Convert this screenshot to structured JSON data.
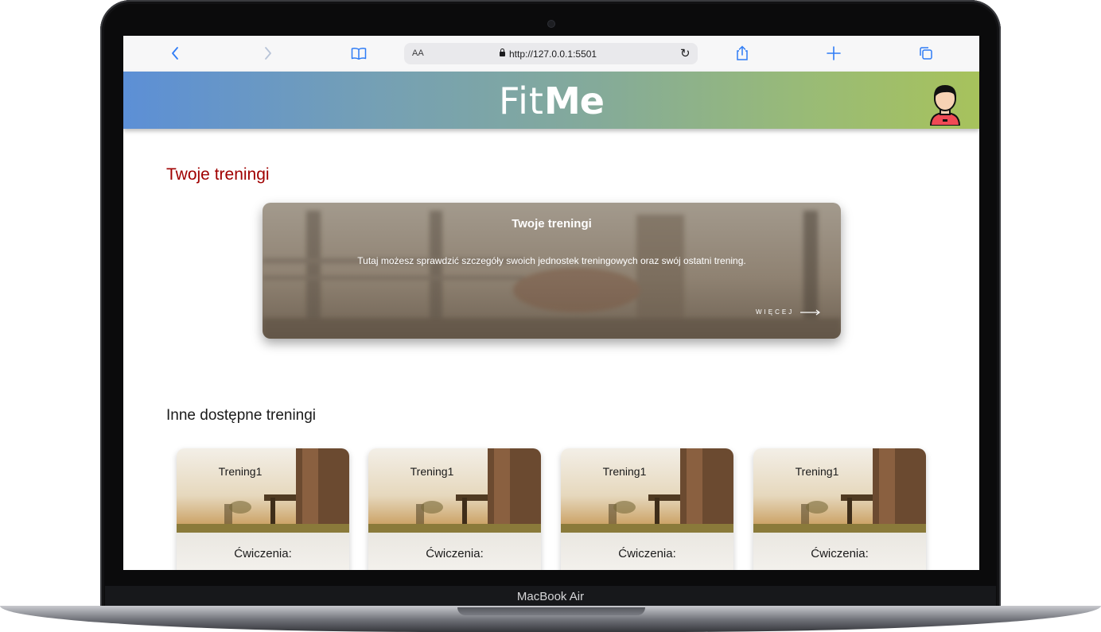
{
  "device": {
    "label": "MacBook Air"
  },
  "browser": {
    "text_size_label": "AA",
    "url": "http://127.0.0.1:5501"
  },
  "site": {
    "logo_part1": "Fit",
    "logo_part2": "Me"
  },
  "main": {
    "section_title": "Twoje treningi",
    "hero": {
      "title": "Twoje treningi",
      "text": "Tutaj możesz sprawdzić szczegóły swoich jednostek treningowych oraz swój ostatni trening.",
      "more_label": "WIĘCEJ"
    },
    "other_title": "Inne dostępne treningi",
    "cards": [
      {
        "title": "Trening1",
        "footer": "Ćwiczenia:"
      },
      {
        "title": "Trening1",
        "footer": "Ćwiczenia:"
      },
      {
        "title": "Trening1",
        "footer": "Ćwiczenia:"
      },
      {
        "title": "Trening1",
        "footer": "Ćwiczenia:"
      }
    ]
  },
  "colors": {
    "accent_blue": "#2f7cf6",
    "title_red": "#a00000",
    "header_gradient_start": "#5c8fd6",
    "header_gradient_end": "#a7c25c"
  },
  "icons": [
    "back-icon",
    "forward-icon",
    "bookmarks-icon",
    "lock-icon",
    "reload-icon",
    "share-icon",
    "new-tab-icon",
    "tabs-icon",
    "user-avatar-icon",
    "arrow-right-icon"
  ]
}
